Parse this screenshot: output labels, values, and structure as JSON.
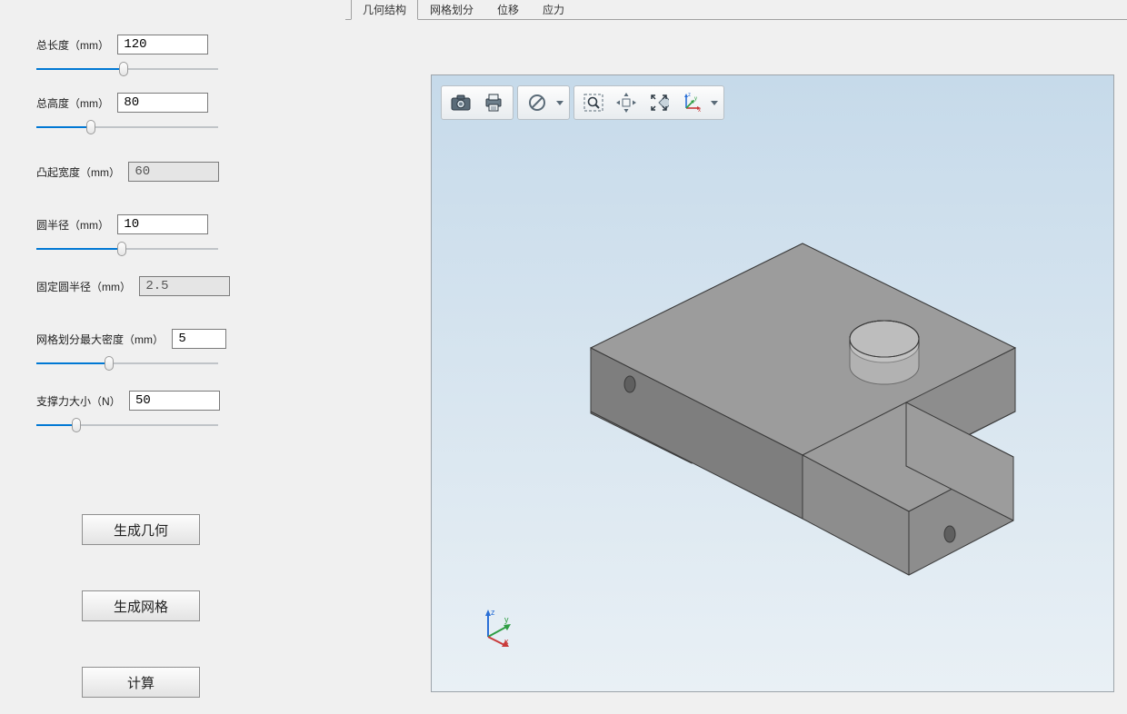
{
  "params": {
    "total_length": {
      "label": "总长度（mm）",
      "value": "120",
      "readonly": false,
      "slider_pct": 48
    },
    "total_height": {
      "label": "总高度（mm）",
      "value": "80",
      "readonly": false,
      "slider_pct": 30
    },
    "bump_width": {
      "label": "凸起宽度（mm）",
      "value": "60",
      "readonly": true,
      "slider_pct": null
    },
    "circle_radius": {
      "label": "圆半径（mm）",
      "value": "10",
      "readonly": false,
      "slider_pct": 47
    },
    "fixed_radius": {
      "label": "固定圆半径（mm）",
      "value": "2.5",
      "readonly": true,
      "slider_pct": null
    },
    "mesh_density": {
      "label": "网格划分最大密度（mm）",
      "value": "5",
      "readonly": false,
      "slider_pct": 40
    },
    "force": {
      "label": "支撑力大小（N）",
      "value": "50",
      "readonly": false,
      "slider_pct": 22
    }
  },
  "buttons": {
    "gen_geometry": "生成几何",
    "gen_mesh": "生成网格",
    "compute": "计算"
  },
  "tabs": [
    "几何结构",
    "网格划分",
    "位移",
    "应力"
  ],
  "active_tab_index": 0,
  "toolbar": {
    "camera": "camera-icon",
    "print": "print-icon",
    "nosign": "nosign-icon",
    "zoom_box": "zoom-box-icon",
    "pan": "pan-icon",
    "fit": "fit-icon",
    "axes": "axes-icon"
  },
  "axes_legend": {
    "x": "x",
    "y": "y",
    "z": "z"
  }
}
